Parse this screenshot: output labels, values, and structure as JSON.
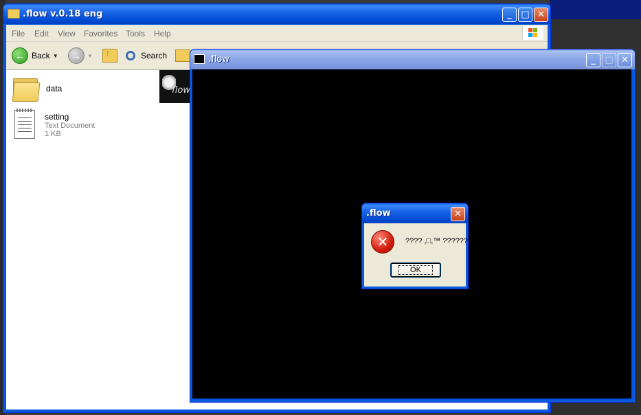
{
  "explorer": {
    "title": ".flow v.0.18 eng",
    "menu": [
      "File",
      "Edit",
      "View",
      "Favorites",
      "Tools",
      "Help"
    ],
    "toolbar": {
      "back_label": "Back",
      "search_label": "Search"
    },
    "files": [
      {
        "name": "data",
        "type": "folder"
      },
      {
        "name": "setting",
        "type_label": "Text Document",
        "size": "1 KB"
      }
    ],
    "thumb_text": "flow"
  },
  "game_window": {
    "title": ".flow",
    "background": "#000000"
  },
  "dialog": {
    "title": ".flow",
    "message": "???? ,□,™ ??????",
    "ok_label": "OK"
  },
  "colors": {
    "xp_blue": "#0054e3",
    "close_red": "#c9401c",
    "dialog_face": "#ece9d8"
  }
}
